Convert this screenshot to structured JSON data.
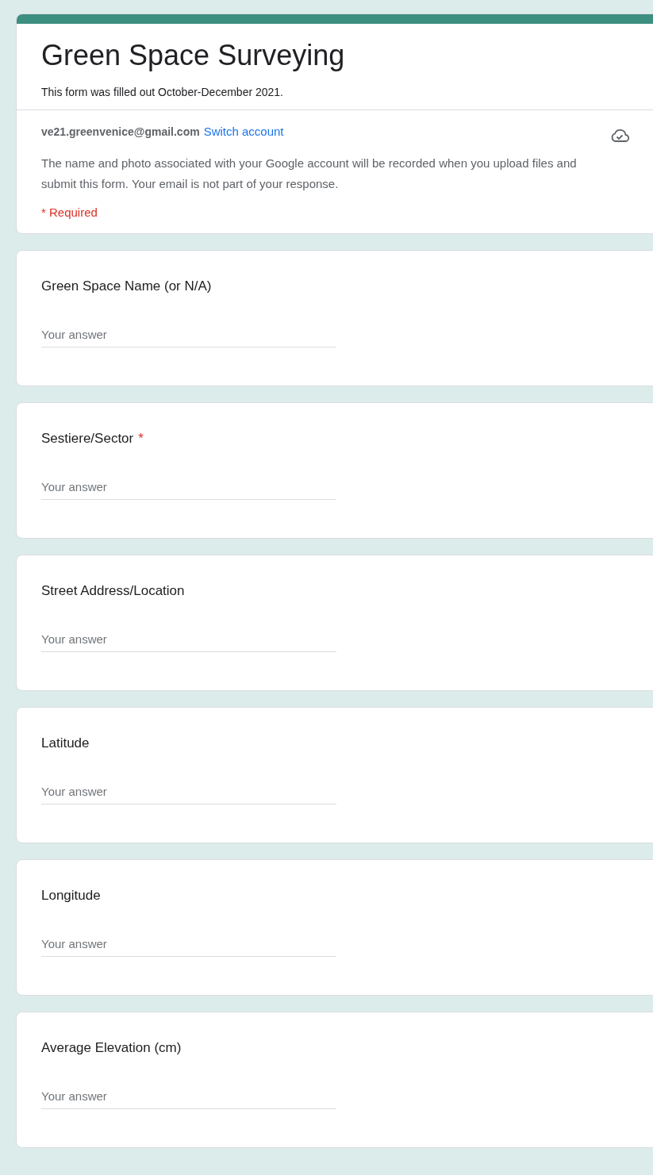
{
  "form": {
    "title": "Green Space Surveying",
    "description": "This form was filled out October-December 2021."
  },
  "account": {
    "email": "ve21.greenvenice@gmail.com",
    "switch_link": "Switch account",
    "notice": "The name and photo associated with your Google account will be recorded when you upload files and submit this form. Your email is not part of your response.",
    "required_note": "* Required"
  },
  "questions": [
    {
      "label": "Green Space Name (or N/A)",
      "placeholder": "Your answer"
    },
    {
      "label": "Sestiere/Sector",
      "required_mark": "*",
      "placeholder": "Your answer"
    },
    {
      "label": "Street Address/Location",
      "placeholder": "Your answer"
    },
    {
      "label": "Latitude",
      "placeholder": "Your answer"
    },
    {
      "label": "Longitude",
      "placeholder": "Your answer"
    },
    {
      "label": "Average Elevation (cm)",
      "placeholder": "Your answer"
    }
  ]
}
